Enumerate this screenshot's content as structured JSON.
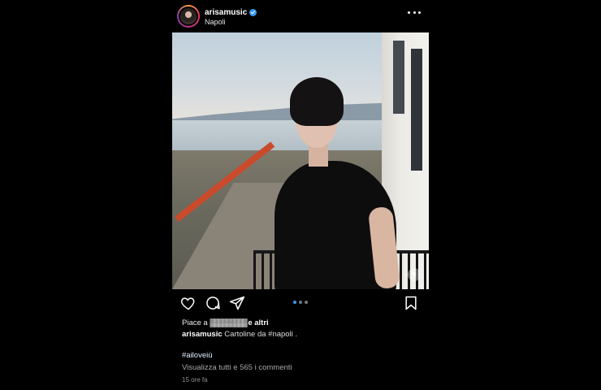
{
  "header": {
    "username": "arisamusic",
    "location": "Napoli",
    "verified": true,
    "avatar_icon": "profile-avatar"
  },
  "photo": {
    "carousel_index": 1,
    "carousel_count": 3
  },
  "actions": {
    "icons": [
      "heart-icon",
      "comment-icon",
      "share-icon",
      "bookmark-icon"
    ]
  },
  "likes": {
    "prefix": "Piace a",
    "obscured_names": "▓▓▓▓▓▓▓▓▓",
    "suffix": "e altri"
  },
  "caption": {
    "username": "arisamusic",
    "text": "Cartoline da #napoli ."
  },
  "hashtag": "#ailoveiù",
  "comments_link": "Visualizza tutti e 565 i commenti",
  "timestamp": "15 ore fa",
  "colors": {
    "background": "#000000",
    "verified": "#3897f0",
    "muted_text": "#a8a8a8"
  }
}
